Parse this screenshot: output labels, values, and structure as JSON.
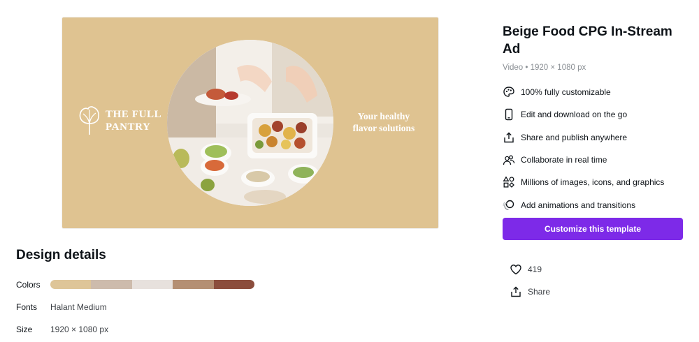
{
  "colors": {
    "preview_background": "#dfc391",
    "accent": "#7d2ae8"
  },
  "preview": {
    "logo_text": "THE FULL PANTRY",
    "tagline": "Your healthy flavor solutions"
  },
  "design_details": {
    "title": "Design details",
    "colors_label": "Colors",
    "palette": [
      "#dec598",
      "#cdbbac",
      "#e7e1dd",
      "#b48f73",
      "#8b4d3c"
    ],
    "fonts_label": "Fonts",
    "fonts_value": "Halant Medium",
    "size_label": "Size",
    "size_value": "1920 × 1080 px"
  },
  "template": {
    "title": "Beige Food CPG In-Stream Ad",
    "meta": "Video • 1920 × 1080 px",
    "features": [
      {
        "icon": "palette-icon",
        "label": "100% fully customizable"
      },
      {
        "icon": "phone-icon",
        "label": "Edit and download on the go"
      },
      {
        "icon": "share-icon",
        "label": "Share and publish anywhere"
      },
      {
        "icon": "people-icon",
        "label": "Collaborate in real time"
      },
      {
        "icon": "shapes-icon",
        "label": "Millions of images, icons, and graphics"
      },
      {
        "icon": "animation-icon",
        "label": "Add animations and transitions"
      }
    ],
    "cta_label": "Customize this template",
    "likes": "419",
    "share_label": "Share"
  }
}
